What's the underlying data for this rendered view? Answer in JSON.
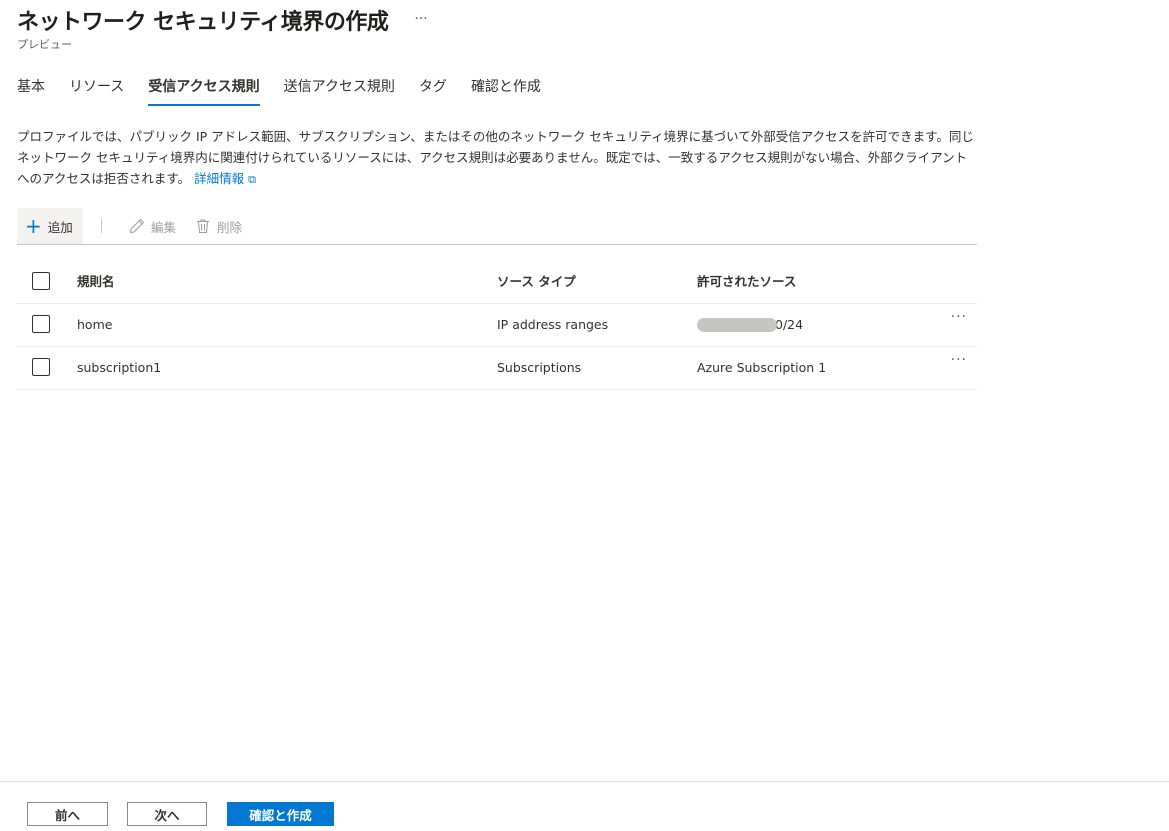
{
  "header": {
    "title": "ネットワーク セキュリティ境界の作成",
    "more": "···",
    "subtitle": "プレビュー"
  },
  "tabs": [
    {
      "label": "基本",
      "active": false
    },
    {
      "label": "リソース",
      "active": false
    },
    {
      "label": "受信アクセス規則",
      "active": true
    },
    {
      "label": "送信アクセス規則",
      "active": false
    },
    {
      "label": "タグ",
      "active": false
    },
    {
      "label": "確認と作成",
      "active": false
    }
  ],
  "description": {
    "text": "プロファイルでは、パブリック IP アドレス範囲、サブスクリプション、またはその他のネットワーク セキュリティ境界に基づいて外部受信アクセスを許可できます。同じネットワーク セキュリティ境界内に関連付けられているリソースには、アクセス規則は必要ありません。既定では、一致するアクセス規則がない場合、外部クライアントへのアクセスは拒否されます。",
    "link": "詳細情報"
  },
  "toolbar": {
    "add_label": "追加",
    "edit_label": "編集",
    "delete_label": "削除"
  },
  "table": {
    "columns": [
      "規則名",
      "ソース タイプ",
      "許可されたソース"
    ],
    "rows": [
      {
        "name": "home",
        "type": "IP address ranges",
        "source": "0/24"
      },
      {
        "name": "subscription1",
        "type": "Subscriptions",
        "source": "Azure Subscription 1"
      }
    ],
    "row_more": "···"
  },
  "footer": {
    "prev_label": "前へ",
    "next_label": "次へ",
    "create_label": "確認と作成"
  },
  "colors": {
    "accent": "#0078d4",
    "text": "#323130",
    "disabled": "#a19f9d"
  }
}
